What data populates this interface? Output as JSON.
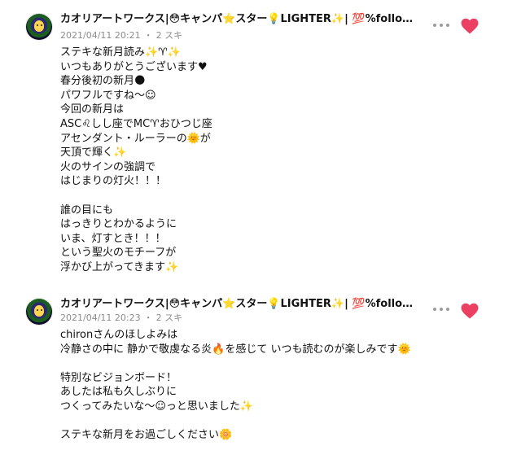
{
  "comments": [
    {
      "author": "カオリアートワークス|😳キャンパ⭐スター💡LIGHTER✨| 💯%follow ba...",
      "date": "2021/04/11 20:21",
      "likes": "2 スキ",
      "text": "ステキな新月読み✨♈✨\nいつもありがとうございます♥\n春分後初の新月🌑\nパワフルですね〜☺\n今回の新月は\nASC♌しし座でMC♈おひつじ座\nアセンダント・ルーラーの🌞が\n天頂で輝く✨\n火のサインの強調で\nはじまりの灯火！！！\n\n誰の目にも\nはっきりとわかるように\nいま、灯すとき！！！\nという聖火のモチーフが\n浮かび上がってきます✨"
    },
    {
      "author": "カオリアートワークス|😳キャンパ⭐スター💡LIGHTER✨| 💯%follow ba...",
      "date": "2021/04/11 20:23",
      "likes": "2 スキ",
      "text": "chironさんのほしよみは\n冷静さの中に 静かで敬虔なる炎🔥を感じて いつも読むのが楽しみです🌞\n\n特別なビジョンボード！\nあしたは私も久しぶりに\nつくってみたいな〜☺っと思いました✨\n\nステキな新月をお過ごしください🌼"
    }
  ],
  "colors": {
    "heart": "#ec4063",
    "meta": "#8c8c8c",
    "dots": "#9b9b9b"
  },
  "icons": {
    "more": "more-dots-icon",
    "like": "heart-icon"
  }
}
